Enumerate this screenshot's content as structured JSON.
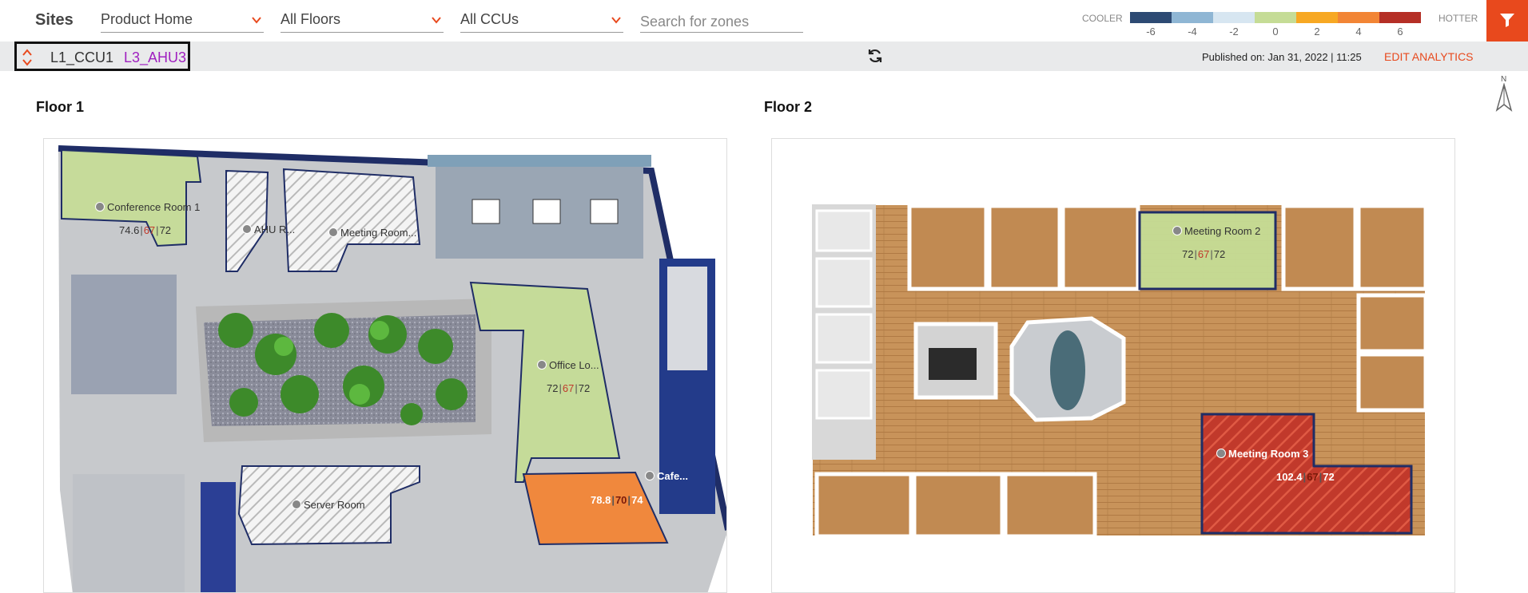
{
  "header": {
    "title": "Sites",
    "site_dropdown": "Product Home",
    "floor_dropdown": "All Floors",
    "ccu_dropdown": "All CCUs",
    "search_placeholder": "Search for zones"
  },
  "legend": {
    "cooler_label": "COOLER",
    "hotter_label": "HOTTER",
    "ticks": [
      "-6",
      "-4",
      "-2",
      "0",
      "2",
      "4",
      "6"
    ],
    "colors": [
      "#2d4a73",
      "#8fb6d4",
      "#d7e6f1",
      "#c5dc96",
      "#f7a823",
      "#f28535",
      "#b52f26"
    ]
  },
  "filter_button": {
    "icon": "filter-icon",
    "color": "#e8491d"
  },
  "subbar": {
    "ccu_label": "L1_CCU1",
    "ahu_label": "L3_AHU3",
    "published": "Published on: Jan 31, 2022 | 11:25",
    "edit_analytics": "EDIT ANALYTICS"
  },
  "compass": {
    "label": "N"
  },
  "floors": [
    {
      "title": "Floor 1",
      "zones": [
        {
          "name": "Conference Room 1",
          "current": "74.6",
          "mid": "67",
          "setpoint": "72"
        },
        {
          "name": "AHU R..."
        },
        {
          "name": "Meeting Room..."
        },
        {
          "name": "Office Lo...",
          "current": "72",
          "mid": "67",
          "setpoint": "72"
        },
        {
          "name": "Cafe...",
          "current": "78.8",
          "mid": "70",
          "setpoint": "74"
        },
        {
          "name": "Server Room"
        }
      ]
    },
    {
      "title": "Floor 2",
      "zones": [
        {
          "name": "Meeting Room 2",
          "current": "72",
          "mid": "67",
          "setpoint": "72"
        },
        {
          "name": "Meeting Room 3",
          "current": "102.4",
          "mid": "67",
          "setpoint": "72"
        }
      ]
    }
  ]
}
